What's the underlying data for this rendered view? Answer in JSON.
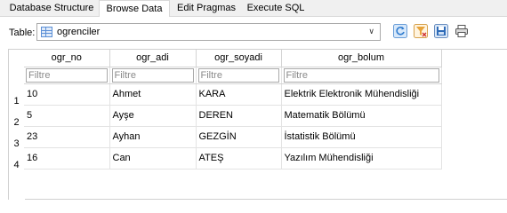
{
  "tabs": [
    {
      "label": "Database Structure"
    },
    {
      "label": "Browse Data"
    },
    {
      "label": "Edit Pragmas"
    },
    {
      "label": "Execute SQL"
    }
  ],
  "active_tab": "Browse Data",
  "toolbar": {
    "table_label": "Table:",
    "selected_table": "ogrenciler",
    "buttons": [
      {
        "name": "refresh-icon",
        "color": "#2e7bcf"
      },
      {
        "name": "clear-filters-icon",
        "color": "#e8a33a"
      },
      {
        "name": "save-table-icon",
        "color": "#2e6bb8"
      },
      {
        "name": "print-icon",
        "color": "#555555"
      }
    ]
  },
  "grid": {
    "columns": [
      "ogr_no",
      "ogr_adi",
      "ogr_soyadi",
      "ogr_bolum"
    ],
    "filter_placeholder": "Filtre",
    "rows": [
      {
        "num": "1",
        "cells": [
          "10",
          "Ahmet",
          "KARA",
          "Elektrik Elektronik Mühendisliği"
        ]
      },
      {
        "num": "2",
        "cells": [
          "5",
          "Ayşe",
          "DEREN",
          "Matematik Bölümü"
        ]
      },
      {
        "num": "3",
        "cells": [
          "23",
          "Ayhan",
          "GEZGİN",
          "İstatistik Bölümü"
        ]
      },
      {
        "num": "4",
        "cells": [
          "16",
          "Can",
          "ATEŞ",
          "Yazılım Mühendisliği"
        ]
      }
    ]
  }
}
